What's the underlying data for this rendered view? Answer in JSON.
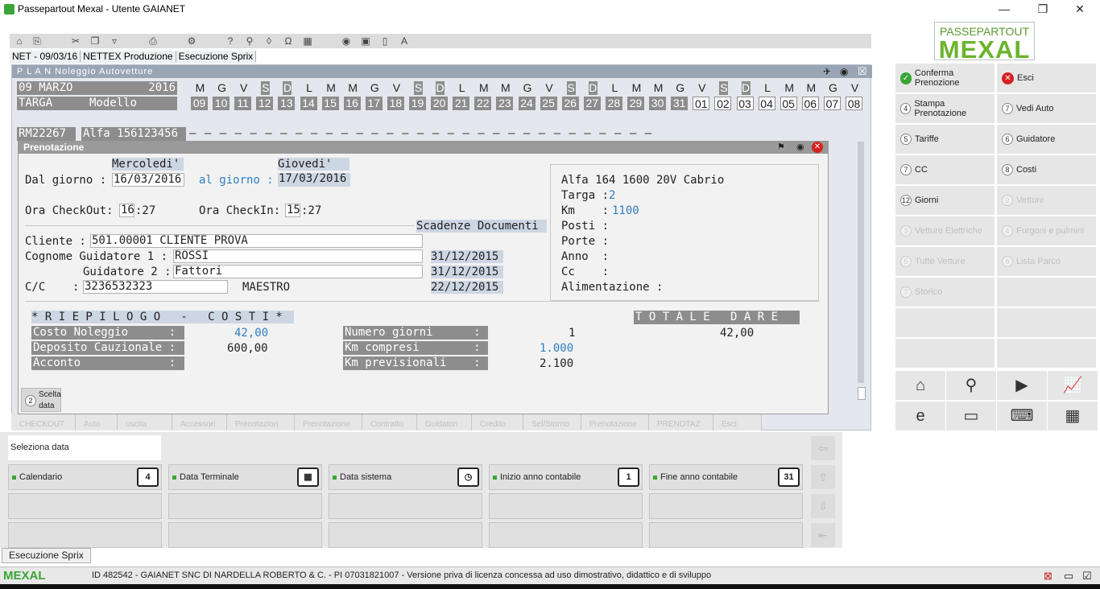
{
  "window": {
    "title": "Passepartout Mexal - Utente GAIANET",
    "min": "—",
    "max": "❐",
    "close": "✕"
  },
  "breadcrumb": [
    "NET - 09/03/16",
    "NETTEX Produzione",
    "Esecuzione Sprix"
  ],
  "logo": {
    "line1": "PASSEPARTOUT",
    "line2": "MEXAL"
  },
  "plan": {
    "title": "P L A N  Noleggio Autovetture",
    "day": "09",
    "month": "MARZO",
    "year": "2016",
    "col_targa": "TARGA",
    "col_modello": "Modello",
    "weekdays": [
      "M",
      "G",
      "V",
      "S",
      "D",
      "L",
      "M",
      "M",
      "G",
      "V",
      "S",
      "D",
      "L",
      "M",
      "M",
      "G",
      "V",
      "S",
      "D",
      "L",
      "M",
      "M",
      "G",
      "V",
      "S",
      "D",
      "L",
      "M",
      "M",
      "G",
      "V"
    ],
    "days": [
      "09",
      "10",
      "11",
      "12",
      "13",
      "14",
      "15",
      "16",
      "17",
      "18",
      "19",
      "20",
      "21",
      "22",
      "23",
      "24",
      "25",
      "26",
      "27",
      "28",
      "29",
      "30",
      "31",
      "01",
      "02",
      "03",
      "04",
      "05",
      "06",
      "07",
      "08"
    ],
    "row1_targa": "RM22267",
    "row1_modello": "Alfa 156123456"
  },
  "dialog": {
    "title": "Prenotazione",
    "day_from_name": "Mercoledi'",
    "day_to_name": "Giovedi'",
    "dal_label": "Dal giorno :",
    "dal_value": "16/03/2016",
    "al_label": "al giorno :",
    "al_value": "17/03/2016",
    "checkout_label": "Ora CheckOut:",
    "checkout_h": "16",
    "checkout_m": ":27",
    "checkin_label": "Ora CheckIn:",
    "checkin_h": "15",
    "checkin_m": ":27",
    "scadenze_label": "Scadenze Documenti",
    "cliente_label": "Cliente :",
    "cliente_value": "501.00001 CLIENTE PROVA",
    "guid1_label": "Cognome Guidatore 1 :",
    "guid1_value": "ROSSI",
    "guid1_date": "31/12/2015",
    "guid2_label": "Guidatore 2 :",
    "guid2_value": "Fattori",
    "guid2_date": "31/12/2015",
    "cc_label": "C/C    :",
    "cc_value": "3236532323",
    "cc_type": "MAESTRO",
    "cc_date": "22/12/2015",
    "car_name": "Alfa 164 1600 20V Cabrio",
    "targa_label": "Targa :",
    "targa_value": "2",
    "km_label": "Km    :",
    "km_value": "1100",
    "posti_label": "Posti :",
    "porte_label": "Porte :",
    "anno_label": "Anno  :",
    "cc2_label": "Cc    :",
    "alim_label": "Alimentazione :",
    "riepilogo": "* R I E P I L O G O   -   C O S T I *",
    "totale_label": "T O T A L E   D A R E",
    "costo_label": "Costo Noleggio      :",
    "costo_value": "42,00",
    "deposito_label": "Deposito Cauzionale :",
    "deposito_value": "600,00",
    "acconto_label": "Acconto             :",
    "numgiorni_label": "Numero giorni      :",
    "numgiorni_value": "1",
    "kmcompresi_label": "Km compresi        :",
    "kmcompresi_value": "1.000",
    "kmprev_label": "Km previsionali    :",
    "kmprev_value": "2.100",
    "totale_value": "42,00",
    "scelta_num": "2",
    "scelta_label1": "Scelta",
    "scelta_label2": "data"
  },
  "plan_tabs": [
    "CHECKOUT",
    "Auto",
    "uscita",
    "Accessori",
    "Prenotazion",
    "Prenotazione",
    "Contratto",
    "Guidatori",
    "Credito",
    "Sel/Storno",
    "Prenotazione",
    "PRENOTAZ",
    "Esci"
  ],
  "right_panel": [
    {
      "label": "Conferma Prenozione",
      "icon": "ok",
      "enabled": true
    },
    {
      "label": "Esci",
      "icon": "ko",
      "enabled": true
    },
    {
      "label": "Stampa Prenotazione",
      "num": "4",
      "enabled": true
    },
    {
      "label": "Vedi Auto",
      "num": "7",
      "enabled": true
    },
    {
      "label": "Tariffe",
      "num": "5",
      "enabled": true
    },
    {
      "label": "Guidatore",
      "num": "6",
      "enabled": true
    },
    {
      "label": "CC",
      "num": "7",
      "enabled": true
    },
    {
      "label": "Costi",
      "num": "8",
      "enabled": true
    },
    {
      "label": "Giorni",
      "num": "12",
      "enabled": true
    },
    {
      "label": "Vetture",
      "num": "2",
      "enabled": false
    },
    {
      "label": "Vetture Elettriche",
      "num": "3",
      "enabled": false
    },
    {
      "label": "Furgoni e pulmini",
      "num": "4",
      "enabled": false
    },
    {
      "label": "Tutte Vetture",
      "num": "5",
      "enabled": false
    },
    {
      "label": "Lista Parco",
      "num": "6",
      "enabled": false
    },
    {
      "label": "Storico",
      "num": "7",
      "enabled": false
    }
  ],
  "bottom": {
    "seleziona": "Seleziona data",
    "buttons": [
      {
        "label": "Calendario",
        "icon": "4"
      },
      {
        "label": "Data Terminale",
        "icon": "▦"
      },
      {
        "label": "Data sistema",
        "icon": "◷"
      },
      {
        "label": "Inizio anno contabile",
        "icon": "1"
      },
      {
        "label": "Fine anno contabile",
        "icon": "31"
      }
    ]
  },
  "sprix_tab": "Esecuzione Sprix",
  "status": {
    "brand": "MEXAL",
    "info": "ID 482542 - GAIANET SNC DI NARDELLA ROBERTO & C. - PI 07031821007 - Versione priva di licenza concessa ad uso dimostrativo, didattico e di sviluppo"
  }
}
